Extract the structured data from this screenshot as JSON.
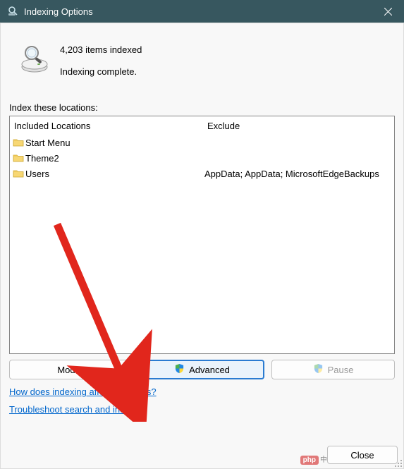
{
  "titlebar": {
    "title": "Indexing Options"
  },
  "status": {
    "items_indexed": "4,203 items indexed",
    "state": "Indexing complete."
  },
  "locations": {
    "label": "Index these locations:",
    "header_included": "Included Locations",
    "header_exclude": "Exclude",
    "rows": [
      {
        "name": "Start Menu",
        "exclude": ""
      },
      {
        "name": "Theme2",
        "exclude": ""
      },
      {
        "name": "Users",
        "exclude": "AppData; AppData; MicrosoftEdgeBackups"
      }
    ]
  },
  "buttons": {
    "modify": "Modify",
    "advanced": "Advanced",
    "pause": "Pause"
  },
  "links": {
    "how": "How does indexing affect searches?",
    "troubleshoot": "Troubleshoot search and indexing"
  },
  "footer": {
    "close": "Close",
    "watermark_text": "中文网",
    "watermark_badge": "php"
  }
}
